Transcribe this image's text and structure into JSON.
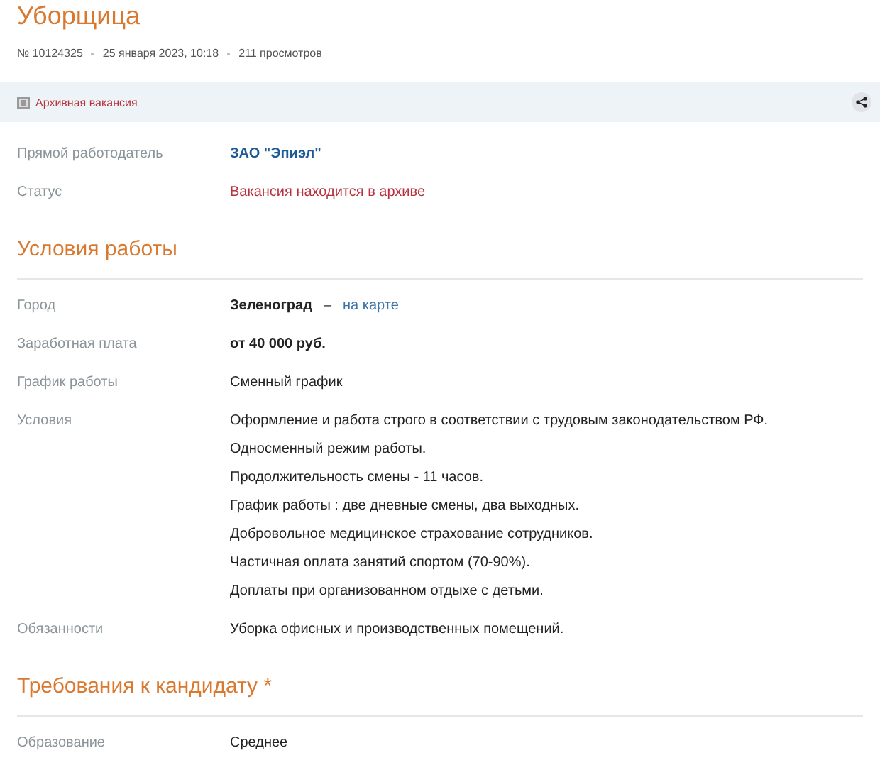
{
  "title": "Уборщица",
  "meta": [
    "№ 10124325",
    "25 января 2023, 10:18",
    "211 просмотров"
  ],
  "banner": {
    "text": "Архивная вакансия"
  },
  "top_fields": [
    {
      "label": "Прямой работодатель",
      "kind": "link",
      "lines": [
        "ЗАО \"Эпиэл\""
      ]
    },
    {
      "label": "Статус",
      "kind": "status",
      "lines": [
        "Вакансия находится в архиве"
      ]
    }
  ],
  "sections": [
    {
      "title": "Условия работы",
      "fields": [
        {
          "label": "Город",
          "kind": "city",
          "lines": [
            "Зеленоград"
          ],
          "separator": "–",
          "map_link": "на карте"
        },
        {
          "label": "Заработная плата",
          "kind": "bold",
          "lines": [
            "от 40 000 руб."
          ]
        },
        {
          "label": "График работы",
          "kind": "plain",
          "lines": [
            "Сменный график"
          ]
        },
        {
          "label": "Условия",
          "kind": "plain",
          "lines": [
            "Оформление и работа строго в соответствии с трудовым законодательством РФ.",
            "Односменный режим работы.",
            "Продолжительность смены - 11 часов.",
            "График работы : две дневные смены, два выходных.",
            "Добровольное медицинское страхование сотрудников.",
            "Частичная оплата занятий спортом (70-90%).",
            "Доплаты при организованном отдыхе с детьми."
          ]
        },
        {
          "label": "Обязанности",
          "kind": "plain",
          "lines": [
            "Уборка офисных и производственных помещений."
          ]
        }
      ]
    },
    {
      "title": "Требования к кандидату *",
      "fields": [
        {
          "label": "Образование",
          "kind": "plain",
          "lines": [
            "Среднее"
          ]
        }
      ]
    }
  ]
}
